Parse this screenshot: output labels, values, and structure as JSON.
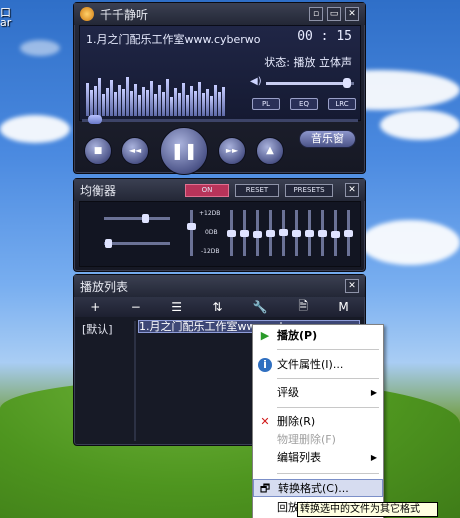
{
  "desktop": {
    "labels": [
      "口",
      "ar"
    ]
  },
  "main": {
    "title": "千千静听",
    "song": "1.月之门配乐工作室www.cyberwo",
    "time": "00 : 15",
    "status": "状态: 播放  立体声",
    "volume_percent": 92,
    "mini_buttons": [
      "PL",
      "EQ",
      "LRC"
    ],
    "controls": {
      "stop": "■",
      "prev": "◄◄",
      "pause": "❚❚",
      "next": "►►",
      "eject": "▲"
    },
    "music_window_button": "音乐窗",
    "window_buttons": [
      "▫",
      "▭",
      "✕"
    ],
    "spectrum_levels": [
      62,
      48,
      55,
      70,
      40,
      52,
      66,
      44,
      58,
      50,
      72,
      46,
      60,
      38,
      54,
      49,
      64,
      41,
      57,
      45,
      68,
      36,
      52,
      43,
      61,
      39,
      55,
      47,
      63,
      42,
      50,
      37,
      58,
      44,
      53
    ]
  },
  "eq": {
    "title": "均衡器",
    "buttons": [
      "ON",
      "RESET",
      "PRESETS"
    ],
    "close": "✕",
    "db_labels": [
      "+12DB",
      "0DB",
      "-12DB"
    ],
    "band_levels": [
      0.35,
      0.5,
      0.5,
      0.52,
      0.5,
      0.48,
      0.5,
      0.5,
      0.5,
      0.52,
      0.5
    ],
    "balance": 0.62,
    "surround": 0.06
  },
  "playlist": {
    "title": "播放列表",
    "close": "✕",
    "tools": [
      "+",
      "−",
      "☰",
      "⇅",
      "🔧",
      "🗎",
      "M"
    ],
    "category": "[默认]",
    "selected_item": "1.月之门配乐工作室www.cyber"
  },
  "context_menu": {
    "items": [
      {
        "label": "播放(P)",
        "icon": "play-icon",
        "bold": true
      },
      {
        "label": "文件属性(I)...",
        "icon": "info-icon"
      },
      {
        "label": "评级",
        "submenu": true
      },
      {
        "label": "删除(R)",
        "icon": "delete-icon"
      },
      {
        "label": "物理删除(F)",
        "disabled": true
      },
      {
        "label": "编辑列表",
        "submenu": true
      },
      {
        "label": "转换格式(C)...",
        "icon": "convert-icon",
        "highlighted": true
      },
      {
        "label": "回放增益"
      }
    ]
  },
  "tooltip": "转换选中的文件为其它格式",
  "colors": {
    "accent": "#b8345a",
    "highlight": "#d6dcf0"
  }
}
